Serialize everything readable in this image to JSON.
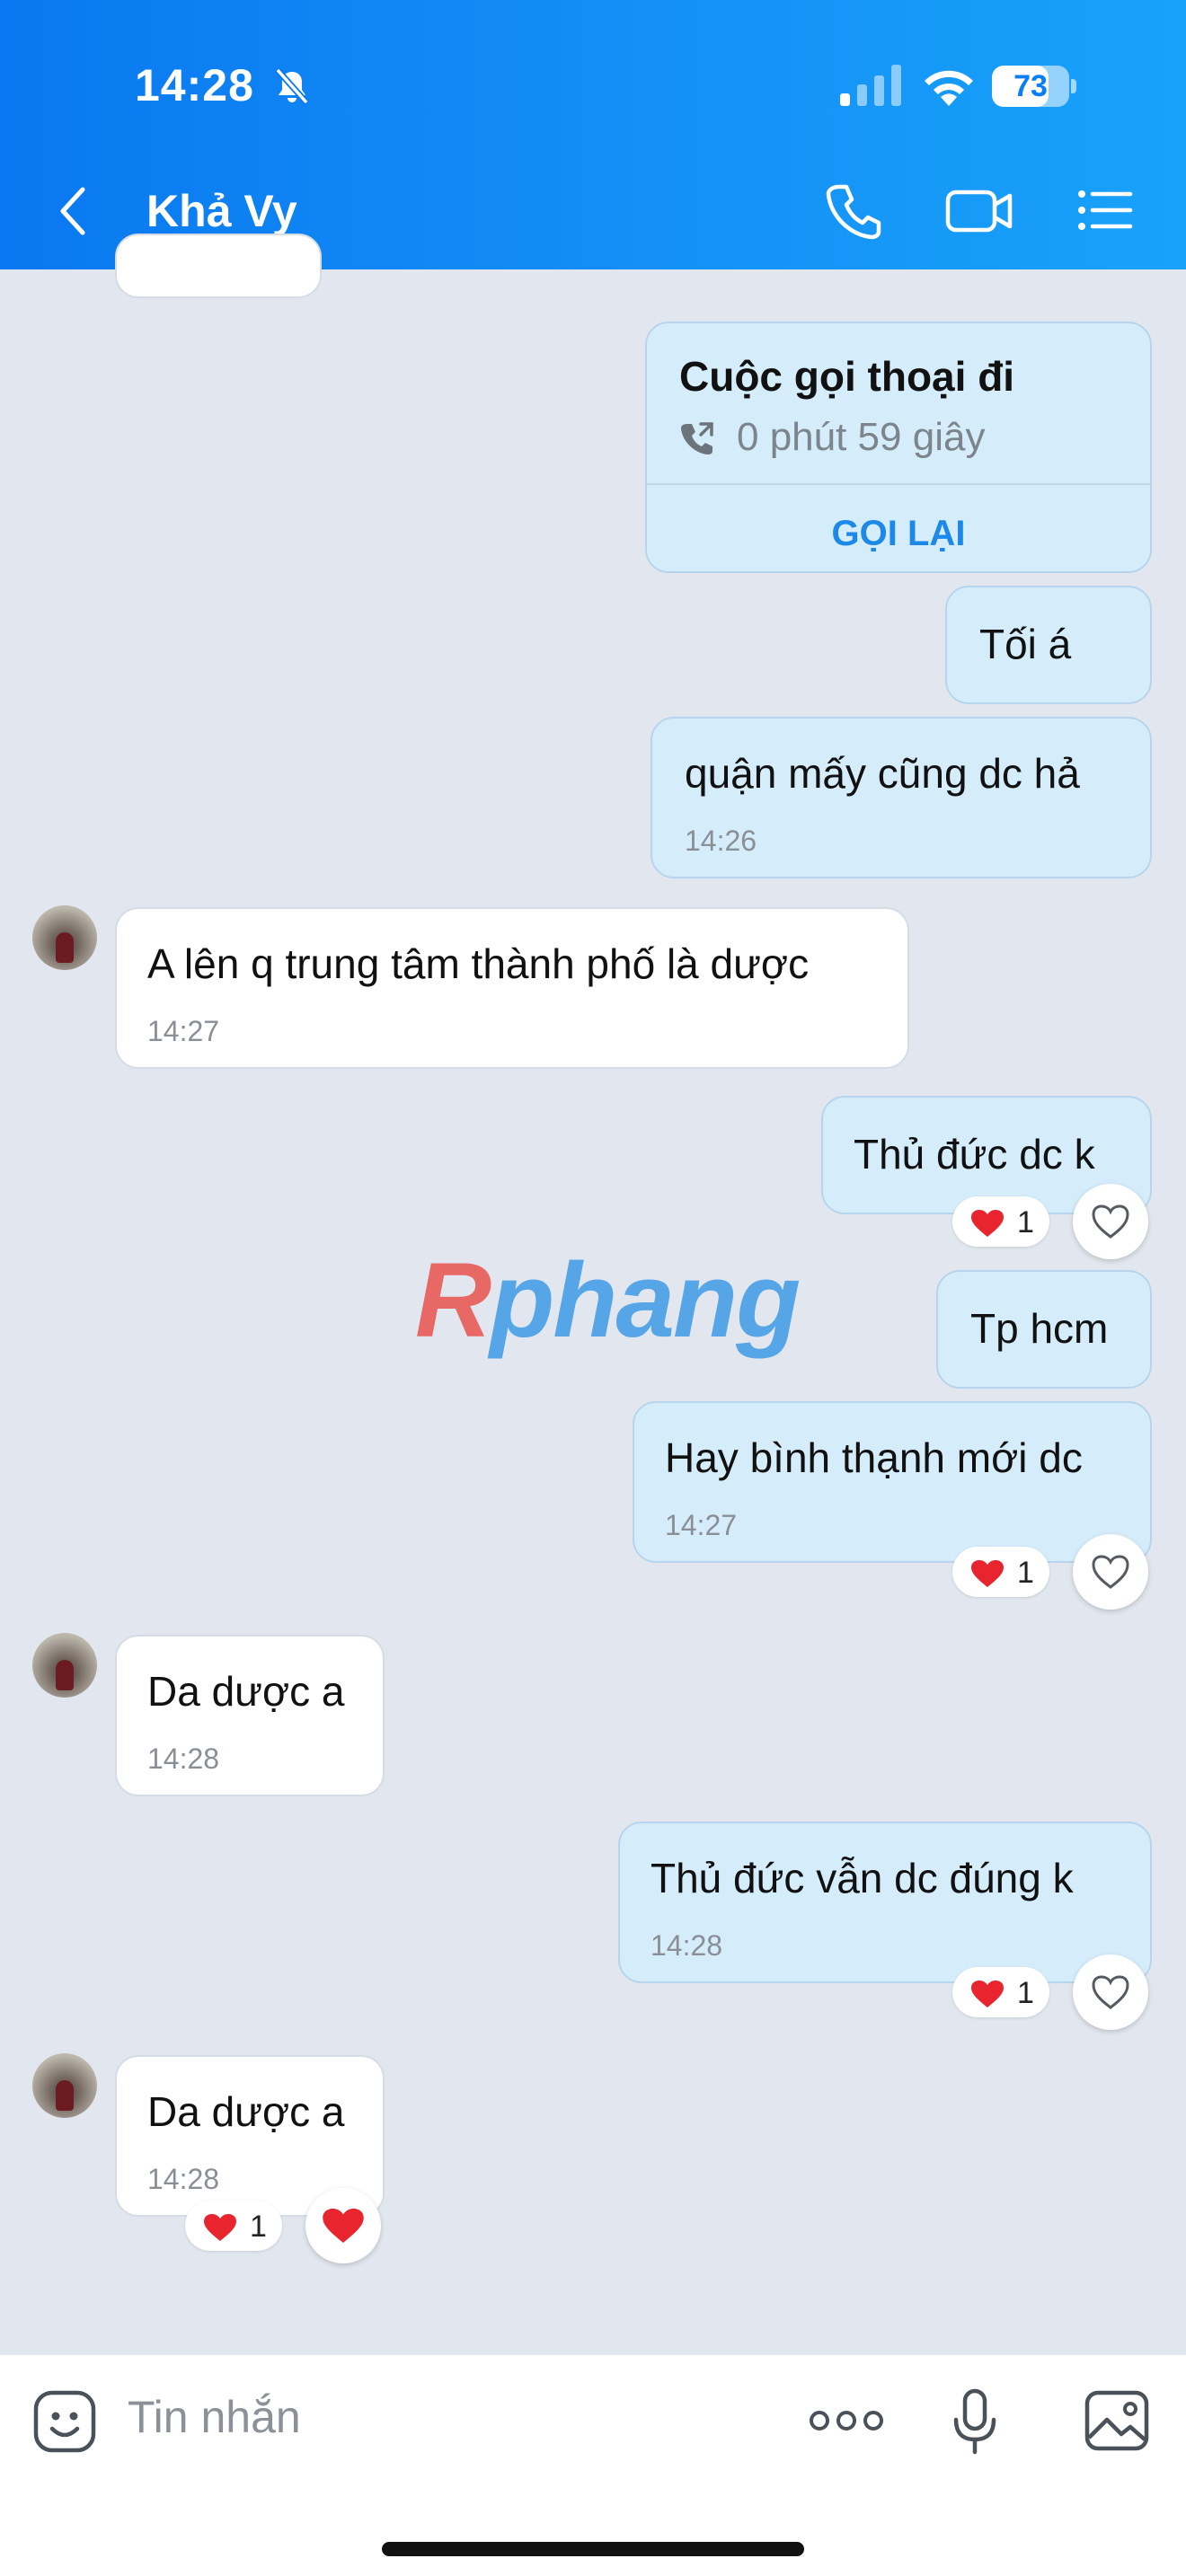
{
  "status_bar": {
    "time": "14:28",
    "battery": "73",
    "battery_level": 0.73
  },
  "header": {
    "contact_name": "Khả Vy"
  },
  "call_card": {
    "title": "Cuộc gọi thoại đi",
    "duration": "0 phút 59 giây",
    "action_label": "GỌI LẠI"
  },
  "messages": [
    {
      "text": "Tối á"
    },
    {
      "text": "quận mấy cũng dc hả",
      "time": "14:26"
    },
    {
      "text": "A lên q trung tâm thành phố là dược",
      "time": "14:27"
    },
    {
      "text": "Thủ đức dc k",
      "reaction_count": "1"
    },
    {
      "text": "Tp hcm"
    },
    {
      "text": "Hay bình thạnh mới dc",
      "time": "14:27",
      "reaction_count": "1"
    },
    {
      "text": "Da dược a",
      "time": "14:28"
    },
    {
      "text": "Thủ đức vẫn dc đúng k",
      "time": "14:28",
      "reaction_count": "1"
    },
    {
      "text": "Da dược a",
      "time": "14:28",
      "reaction_count": "1"
    }
  ],
  "watermark": {
    "text": "Rphang"
  },
  "input": {
    "placeholder": "Tin nhắn"
  },
  "colors": {
    "header_start": "#0a78f0",
    "header_end": "#18a2fa",
    "sent_bubble": "#d5ecfb",
    "received_bubble": "#ffffff",
    "chat_bg": "#e2e7ef",
    "link_blue": "#1c88e8",
    "heart_red": "#e8242f"
  }
}
